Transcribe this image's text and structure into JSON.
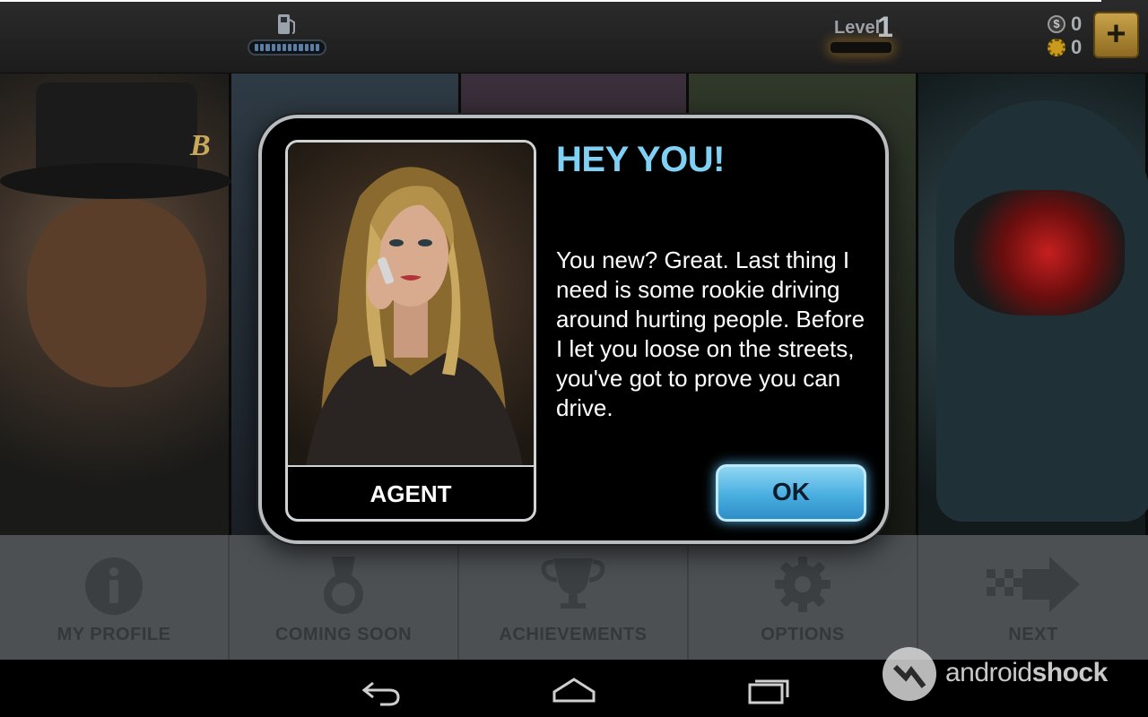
{
  "topbar": {
    "fuel_icon": "gas-pump-icon",
    "fuel_level": 1.0,
    "level_label": "Level",
    "level_value": "1",
    "cash_value": "0",
    "gold_value": "0",
    "add_label": "+"
  },
  "dialog": {
    "title": "HEY YOU!",
    "body": "You new? Great. Last thing I need is some rookie driving around hurting people. Before I let you loose on the streets, you've got to prove you can drive.",
    "character_name": "AGENT",
    "ok_label": "OK"
  },
  "bottom_nav": {
    "items": [
      {
        "label": "MY PROFILE",
        "icon": "info-icon"
      },
      {
        "label": "COMING SOON",
        "icon": "medal-icon"
      },
      {
        "label": "ACHIEVEMENTS",
        "icon": "trophy-icon"
      },
      {
        "label": "OPTIONS",
        "icon": "gear-icon"
      },
      {
        "label": "NEXT",
        "icon": "checkered-arrow-icon"
      }
    ]
  },
  "system_bar": {
    "back_icon": "back-icon",
    "home_icon": "home-icon",
    "recents_icon": "recents-icon"
  },
  "watermark": {
    "text_normal": "android",
    "text_bold": "shock"
  },
  "colors": {
    "title_blue": "#7fd0f3",
    "ok_button": "#49aee0",
    "dialog_border": "#b9bdc0",
    "nav_background": "#4c5053"
  }
}
